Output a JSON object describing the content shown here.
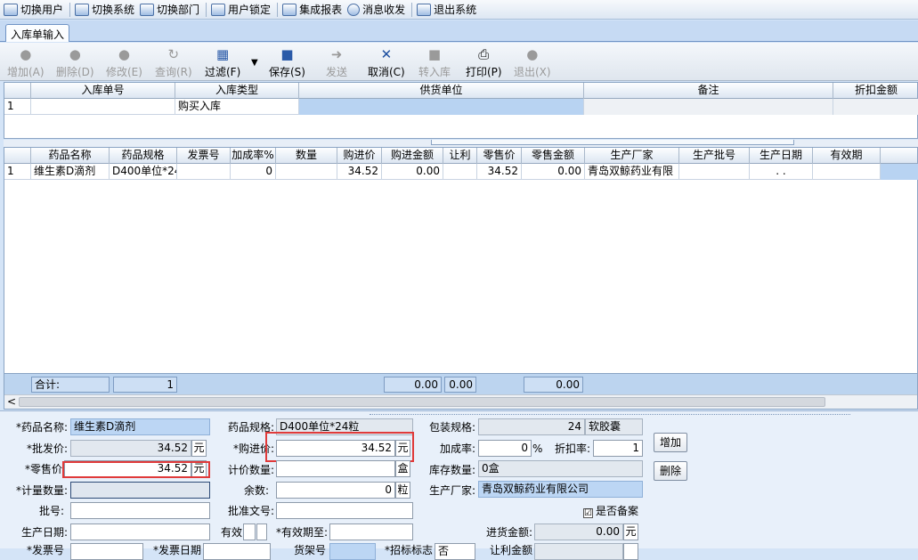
{
  "menubar": {
    "items": [
      {
        "label": "切换用户",
        "icon": "users-icon"
      },
      {
        "label": "切换系统",
        "icon": "system-icon"
      },
      {
        "label": "切换部门",
        "icon": "department-icon"
      },
      {
        "label": "用户锁定",
        "icon": "lock-user-icon"
      },
      {
        "label": "集成报表",
        "icon": "report-icon"
      },
      {
        "label": "消息收发",
        "icon": "info-icon"
      },
      {
        "label": "退出系统",
        "icon": "exit-icon"
      }
    ]
  },
  "tab": {
    "label": "入库单输入"
  },
  "toolbar": {
    "add": "增加(A)",
    "delete": "删除(D)",
    "edit": "修改(E)",
    "query": "查询(R)",
    "filter": "过滤(F)",
    "save": "保存(S)",
    "send": "发送",
    "cancel": "取消(C)",
    "transfer": "转入库",
    "print": "打印(P)",
    "exit": "退出(X)"
  },
  "grid1": {
    "headers": [
      "入库单号",
      "入库类型",
      "供货单位",
      "备注",
      "折扣金额"
    ],
    "rows": [
      {
        "index": "1",
        "number": "",
        "type": "购买入库",
        "supplier": "",
        "note": "",
        "discount": ""
      }
    ]
  },
  "grid2": {
    "headers": [
      "药品名称",
      "药品规格",
      "发票号",
      "加成率%",
      "数量",
      "购进价",
      "购进金额",
      "让利",
      "零售价",
      "零售金额",
      "生产厂家",
      "生产批号",
      "生产日期",
      "有效期"
    ],
    "rows": [
      {
        "index": "1",
        "name": "维生素D滴剂",
        "spec": "D400单位*24",
        "invoice": "",
        "markup": "0",
        "qty": "",
        "buy_price": "34.52",
        "buy_amount": "0.00",
        "rebate": "",
        "retail_price": "34.52",
        "retail_amount": "0.00",
        "maker": "青岛双鲸药业有限",
        "batch": "",
        "prod_date": ". .",
        "expiry": ""
      }
    ],
    "footer": {
      "label": "合计:",
      "count": "1",
      "buy_amount": "0.00",
      "rebate": "0.00",
      "retail_amount": "0.00"
    },
    "scroll_left": "<"
  },
  "form": {
    "drug_name_label": "*药品名称:",
    "drug_name": "维生素D滴剂",
    "drug_spec_label": "药品规格:",
    "drug_spec": "D400单位*24粒",
    "pack_spec_label": "包装规格:",
    "pack_qty": "24",
    "pack_unit": "软胶囊",
    "wholesale_label": "*批发价:",
    "wholesale": "34.52",
    "wholesale_unit": "元",
    "buy_price_label": "*购进价:",
    "buy_price": "34.52",
    "buy_price_unit": "元",
    "markup_label": "加成率:",
    "markup": "0",
    "markup_unit": "%",
    "discount_label": "折扣率:",
    "discount": "1",
    "retail_label": "*零售价",
    "retail": "34.52",
    "retail_unit": "元",
    "count_qty_label": "计价数量:",
    "count_qty": "",
    "count_qty_unit": "盒",
    "stock_label": "库存数量:",
    "stock": "0盒",
    "meter_qty_label": "*计量数量:",
    "meter_qty": "",
    "remain_label": "余数:",
    "remain": "0",
    "remain_unit": "粒",
    "maker_label": "生产厂家:",
    "maker": "青岛双鲸药业有限公司",
    "batch_label": "批号:",
    "batch": "",
    "approval_label": "批准文号:",
    "approval": "",
    "filed_label": "是否备案",
    "filed_checked": "☑",
    "prod_date_label": "生产日期:",
    "prod_date": "",
    "valid_label": "有效",
    "expiry_label": "*有效期至:",
    "expiry": "",
    "in_amount_label": "进货金额:",
    "in_amount": "0.00",
    "in_amount_unit": "元",
    "row7": {
      "invoice_label": "*发票号",
      "invoice_date_label": "*发票日期",
      "shelf_label": "货架号",
      "bid_label": "*招标标志",
      "bid_value": "否",
      "rebate_amount_label": "让利金额"
    },
    "add_button": "增加",
    "delete_button": "删除"
  }
}
